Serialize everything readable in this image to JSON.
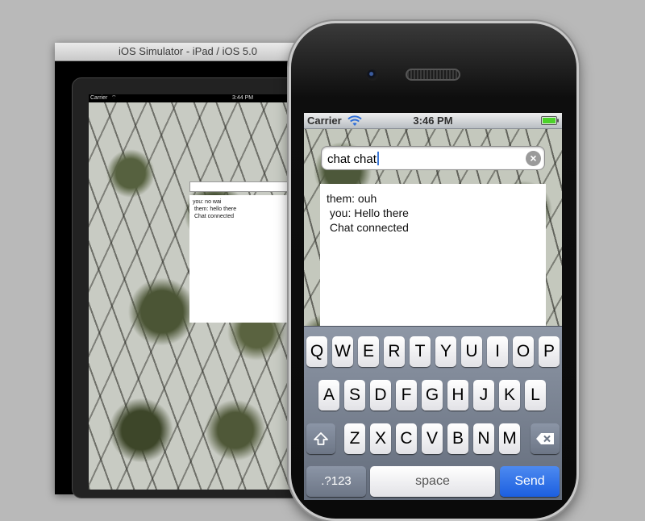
{
  "ipad": {
    "window_title": "iOS Simulator - iPad / iOS 5.0",
    "carrier": "Carrier",
    "time": "3:44 PM",
    "log": [
      "you: no wai",
      " them: hello there",
      " Chat connected"
    ]
  },
  "iphone": {
    "carrier": "Carrier",
    "time": "3:46 PM",
    "input_value": "chat chat",
    "log": [
      "them: ouh",
      " you: Hello there",
      " Chat connected"
    ],
    "keyboard": {
      "row1": [
        "Q",
        "W",
        "E",
        "R",
        "T",
        "Y",
        "U",
        "I",
        "O",
        "P"
      ],
      "row2": [
        "A",
        "S",
        "D",
        "F",
        "G",
        "H",
        "J",
        "K",
        "L"
      ],
      "row3": [
        "Z",
        "X",
        "C",
        "V",
        "B",
        "N",
        "M"
      ],
      "numbers_label": ".?123",
      "space_label": "space",
      "send_label": "Send"
    }
  },
  "colors": {
    "accent": "#1c5fe0",
    "battery": "#4cd22a"
  },
  "icons": [
    "wifi-icon",
    "battery-icon",
    "clear-icon",
    "shift-icon",
    "backspace-icon"
  ]
}
